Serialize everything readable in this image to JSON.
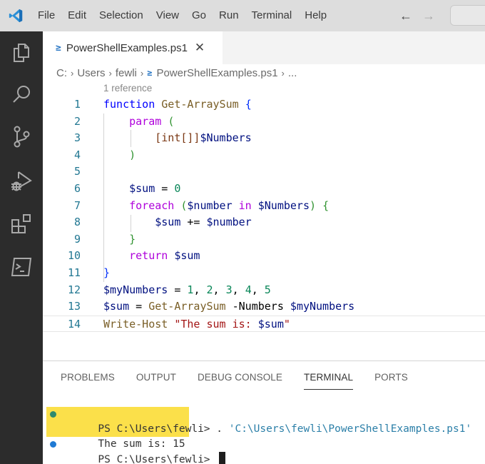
{
  "titlebar": {
    "menu": [
      "File",
      "Edit",
      "Selection",
      "View",
      "Go",
      "Run",
      "Terminal",
      "Help"
    ],
    "back_icon": "arrow-left-icon",
    "forward_icon": "arrow-right-icon"
  },
  "activitybar": {
    "items": [
      {
        "name": "explorer",
        "icon": "files-icon"
      },
      {
        "name": "search",
        "icon": "search-icon"
      },
      {
        "name": "source-control",
        "icon": "source-control-icon"
      },
      {
        "name": "run-debug",
        "icon": "run-debug-icon"
      },
      {
        "name": "extensions",
        "icon": "extensions-icon"
      },
      {
        "name": "powershell",
        "icon": "terminal-icon"
      }
    ]
  },
  "tab": {
    "icon_glyph": "≥",
    "label": "PowerShellExamples.ps1",
    "close_glyph": "✕"
  },
  "breadcrumb": {
    "parts": [
      "C:",
      "Users",
      "fewli",
      "PowerShellExamples.ps1",
      "..."
    ],
    "separator": "›"
  },
  "editor": {
    "codelens": "1 reference",
    "current_line": 14,
    "lines": [
      {
        "n": "1",
        "tokens": [
          [
            "kw",
            "function"
          ],
          [
            "plain",
            " "
          ],
          [
            "fn",
            "Get-ArraySum"
          ],
          [
            "plain",
            " "
          ],
          [
            "br1",
            "{"
          ]
        ]
      },
      {
        "n": "2",
        "tokens": [
          [
            "plain",
            "    "
          ],
          [
            "ctl",
            "param"
          ],
          [
            "plain",
            " "
          ],
          [
            "br2",
            "("
          ]
        ]
      },
      {
        "n": "3",
        "tokens": [
          [
            "plain",
            "        "
          ],
          [
            "br3",
            "[int[]]"
          ],
          [
            "var",
            "$Numbers"
          ]
        ]
      },
      {
        "n": "4",
        "tokens": [
          [
            "plain",
            "    "
          ],
          [
            "br2",
            ")"
          ]
        ]
      },
      {
        "n": "5",
        "tokens": []
      },
      {
        "n": "6",
        "tokens": [
          [
            "plain",
            "    "
          ],
          [
            "var",
            "$sum"
          ],
          [
            "op",
            " = "
          ],
          [
            "num",
            "0"
          ]
        ]
      },
      {
        "n": "7",
        "tokens": [
          [
            "plain",
            "    "
          ],
          [
            "ctl",
            "foreach"
          ],
          [
            "plain",
            " "
          ],
          [
            "br2",
            "("
          ],
          [
            "var",
            "$number"
          ],
          [
            "plain",
            " "
          ],
          [
            "ctl",
            "in"
          ],
          [
            "plain",
            " "
          ],
          [
            "var",
            "$Numbers"
          ],
          [
            "br2",
            ")"
          ],
          [
            "plain",
            " "
          ],
          [
            "br2",
            "{"
          ]
        ]
      },
      {
        "n": "8",
        "tokens": [
          [
            "plain",
            "        "
          ],
          [
            "var",
            "$sum"
          ],
          [
            "op",
            " += "
          ],
          [
            "var",
            "$number"
          ]
        ]
      },
      {
        "n": "9",
        "tokens": [
          [
            "plain",
            "    "
          ],
          [
            "br2",
            "}"
          ]
        ]
      },
      {
        "n": "10",
        "tokens": [
          [
            "plain",
            "    "
          ],
          [
            "ctl",
            "return"
          ],
          [
            "plain",
            " "
          ],
          [
            "var",
            "$sum"
          ]
        ]
      },
      {
        "n": "11",
        "tokens": [
          [
            "br1",
            "}"
          ]
        ]
      },
      {
        "n": "12",
        "tokens": [
          [
            "var",
            "$myNumbers"
          ],
          [
            "op",
            " = "
          ],
          [
            "num",
            "1"
          ],
          [
            "op",
            ", "
          ],
          [
            "num",
            "2"
          ],
          [
            "op",
            ", "
          ],
          [
            "num",
            "3"
          ],
          [
            "op",
            ", "
          ],
          [
            "num",
            "4"
          ],
          [
            "op",
            ", "
          ],
          [
            "num",
            "5"
          ]
        ]
      },
      {
        "n": "13",
        "tokens": [
          [
            "var",
            "$sum"
          ],
          [
            "op",
            " = "
          ],
          [
            "fn",
            "Get-ArraySum"
          ],
          [
            "plain",
            " "
          ],
          [
            "param",
            "-Numbers"
          ],
          [
            "plain",
            " "
          ],
          [
            "var",
            "$myNumbers"
          ]
        ]
      },
      {
        "n": "14",
        "tokens": [
          [
            "fn",
            "Write-Host"
          ],
          [
            "plain",
            " "
          ],
          [
            "str",
            "\"The sum is: "
          ],
          [
            "var",
            "$sum"
          ],
          [
            "str",
            "\""
          ]
        ]
      }
    ]
  },
  "panel": {
    "tabs": [
      "PROBLEMS",
      "OUTPUT",
      "DEBUG CONSOLE",
      "TERMINAL",
      "PORTS"
    ],
    "active_tab": "TERMINAL"
  },
  "terminal": {
    "line1_prompt": "PS C:\\Users\\fewli> ",
    "line1_cmd": ". ",
    "line1_arg": "'C:\\Users\\fewli\\PowerShellExamples.ps1'",
    "line2_output": "The sum is: 15",
    "line3_prompt": "PS C:\\Users\\fewli> ",
    "dot1_color": "#2e8a6e",
    "dot2_color": "#1f7ad4",
    "highlight_color": "#fbe04a"
  },
  "colors": {
    "activitybar_bg": "#2c2c2c",
    "titlebar_bg": "#dddddd",
    "vscode_blue": "#2b78c5"
  }
}
